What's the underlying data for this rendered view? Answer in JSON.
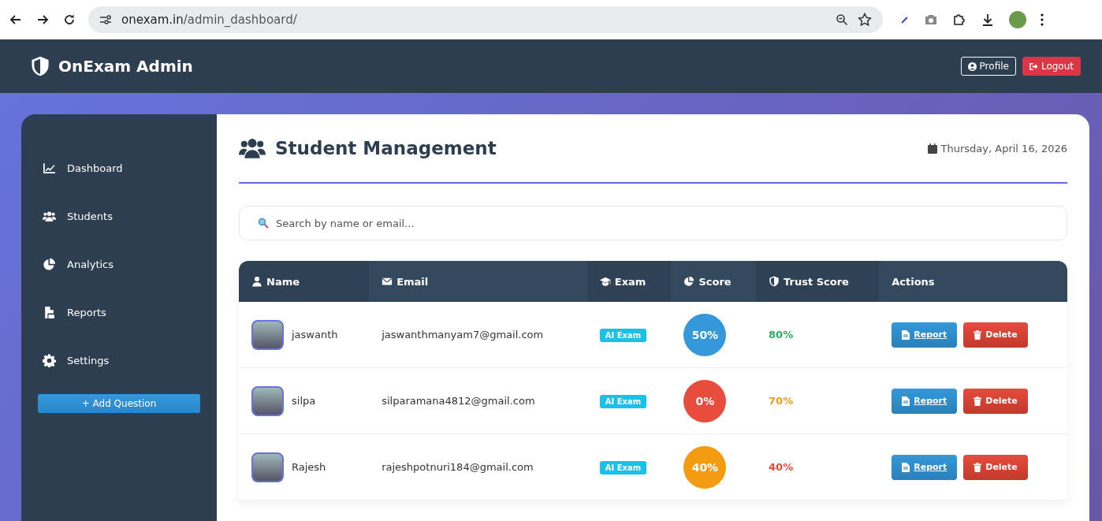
{
  "browser": {
    "url_host": "onexam.in",
    "url_path": "/admin_dashboard/"
  },
  "navbar": {
    "brand": "OnExam Admin",
    "buttons": [
      {
        "label": "Profile",
        "kind": "outline"
      },
      {
        "label": "Logout",
        "kind": "danger"
      }
    ]
  },
  "sidebar": {
    "items": [
      {
        "label": "Dashboard"
      },
      {
        "label": "Students"
      },
      {
        "label": "Analytics"
      },
      {
        "label": "Reports"
      },
      {
        "label": "Settings"
      }
    ],
    "button": "+ Add Question"
  },
  "main": {
    "title": "Student Management",
    "date": "Thursday, April 16, 2026",
    "search": {
      "placeholder": "Search by name or email..."
    }
  },
  "table": {
    "columns": [
      {
        "label": "Name"
      },
      {
        "label": "Email"
      },
      {
        "label": "Exam"
      },
      {
        "label": "Score"
      },
      {
        "label": "Trust Score"
      },
      {
        "label": "Actions"
      }
    ],
    "rows": [
      {
        "name": "jaswanth",
        "email": "jaswanthmanyam7@gmail.com",
        "exam": "AI Exam",
        "score": "50%",
        "color": "#3498db",
        "trust": "80%",
        "kind": "high",
        "report": "Report",
        "delete": "Delete"
      },
      {
        "name": "silpa",
        "email": "silparamana4812@gmail.com",
        "exam": "AI Exam",
        "score": "0%",
        "color": "#e74c3c",
        "trust": "70%",
        "kind": "medium",
        "report": "Report",
        "delete": "Delete"
      },
      {
        "name": "Rajesh",
        "email": "rajeshpotnuri184@gmail.com",
        "exam": "AI Exam",
        "score": "40%",
        "color": "#f39c12",
        "trust": "40%",
        "kind": "low",
        "report": "Report",
        "delete": "Delete"
      }
    ]
  }
}
